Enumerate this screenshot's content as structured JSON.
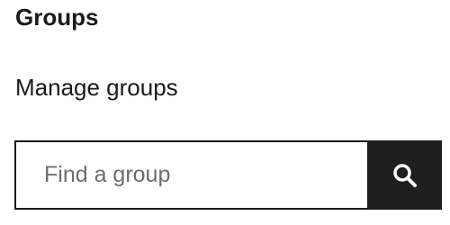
{
  "section": {
    "title": "Groups",
    "manage_link_label": "Manage groups"
  },
  "search": {
    "placeholder": "Find a group",
    "value": "",
    "button_icon": "search-icon"
  },
  "colors": {
    "text": "#1a1a1a",
    "button_background": "#1f1f1f",
    "button_icon": "#ffffff",
    "placeholder": "#6d6d6d",
    "input_border": "#1a1a1a"
  }
}
